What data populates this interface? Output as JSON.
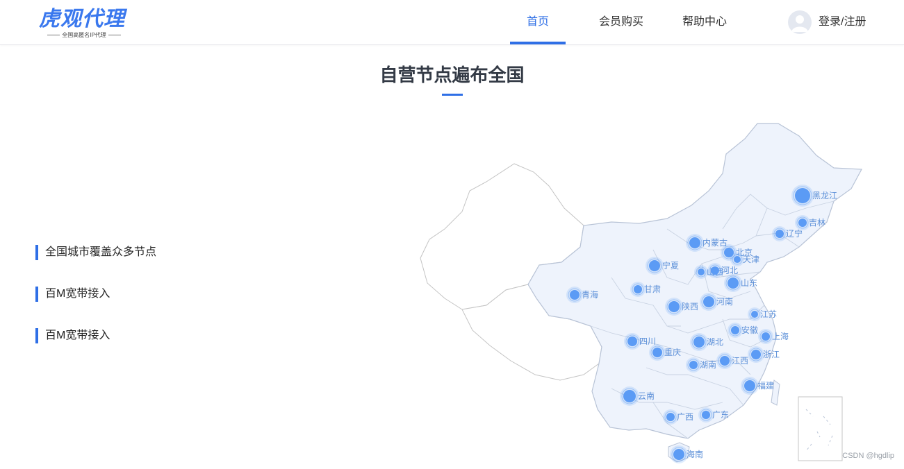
{
  "header": {
    "logo_title": "虎观代理",
    "logo_subtitle": "全国高匿名IP代理",
    "nav": [
      {
        "label": "首页",
        "active": true
      },
      {
        "label": "会员购买",
        "active": false
      },
      {
        "label": "帮助中心",
        "active": false
      }
    ],
    "login_label": "登录/注册"
  },
  "main": {
    "title": "自营节点遍布全国",
    "features": [
      "全国城市覆盖众多节点",
      "百M宽带接入",
      "百M宽带接入"
    ]
  },
  "map": {
    "colors": {
      "fill": "#eef3fc",
      "stroke": "#b8c3d6",
      "dot": "#5b9bf5",
      "label": "#5b8fd8",
      "neutral_stroke": "#c4c4c4"
    },
    "provinces": [
      {
        "name": "黑龙江"
      },
      {
        "name": "吉林"
      },
      {
        "name": "辽宁"
      },
      {
        "name": "内蒙古"
      },
      {
        "name": "北京"
      },
      {
        "name": "天津"
      },
      {
        "name": "宁夏"
      },
      {
        "name": "山西"
      },
      {
        "name": "河北"
      },
      {
        "name": "甘肃"
      },
      {
        "name": "山东"
      },
      {
        "name": "青海"
      },
      {
        "name": "陕西"
      },
      {
        "name": "河南"
      },
      {
        "name": "江苏"
      },
      {
        "name": "安徽"
      },
      {
        "name": "上海"
      },
      {
        "name": "四川"
      },
      {
        "name": "湖北"
      },
      {
        "name": "重庆"
      },
      {
        "name": "浙江"
      },
      {
        "name": "湖南"
      },
      {
        "name": "江西"
      },
      {
        "name": "福建"
      },
      {
        "name": "云南"
      },
      {
        "name": "广西"
      },
      {
        "name": "广东"
      },
      {
        "name": "海南"
      }
    ]
  },
  "footer": {
    "watermark": "CSDN @hgdlip"
  }
}
